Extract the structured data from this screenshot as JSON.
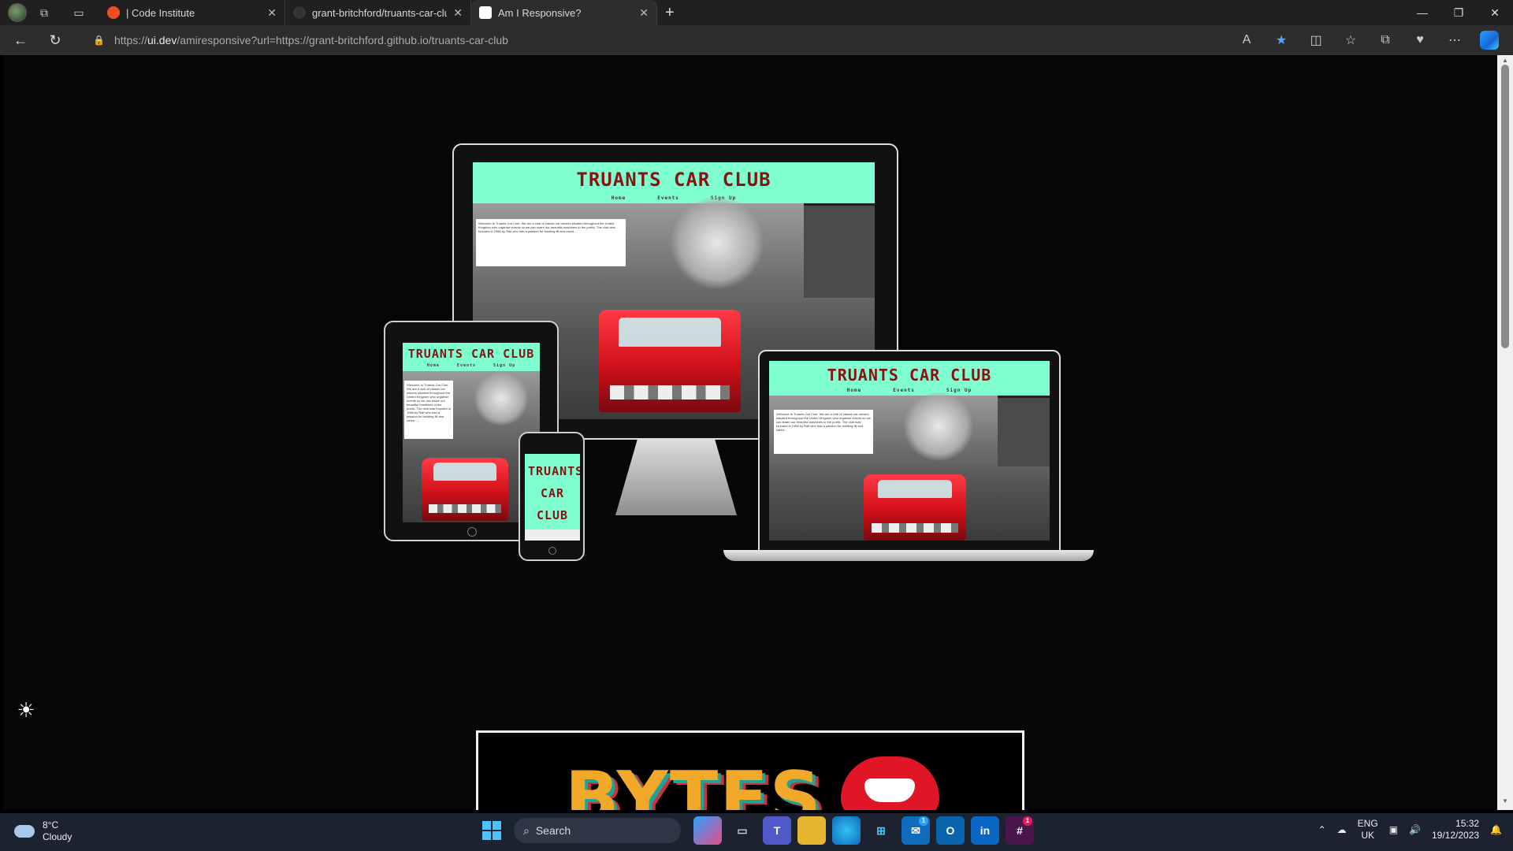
{
  "tabs": [
    {
      "title": "| Code Institute",
      "favicon_color": "#f04e23",
      "active": false
    },
    {
      "title": "grant-britchford/truants-car-club",
      "favicon_color": "#333333",
      "active": false
    },
    {
      "title": "Am I Responsive?",
      "favicon_color": "#ffffff",
      "active": true
    }
  ],
  "address": {
    "prefix": "https://",
    "host": "ui.dev",
    "path": "/amiresponsive?url=https://grant-britchford.github.io/truants-car-club"
  },
  "mockup": {
    "site_title": "TRUANTS CAR CLUB",
    "phone_title": "TRUANTS CAR CLUB",
    "nav": [
      "Home",
      "Events",
      "Sign Up"
    ],
    "info_text": "Welcome to Truants Car Club. We are a club of classic car owners situated throughout the United Kingdom who organise events so we can share our beautiful machines to the public. The club was founded in 1986 by Ralf who had a passion for building fili and cared..."
  },
  "promo": {
    "text": "BYTES"
  },
  "taskbar": {
    "temperature": "8°C",
    "condition": "Cloudy",
    "search_label": "Search",
    "lang_top": "ENG",
    "lang_bottom": "UK",
    "time": "15:32",
    "date": "19/12/2023",
    "mail_badge": "1",
    "slack_badge": "1"
  }
}
